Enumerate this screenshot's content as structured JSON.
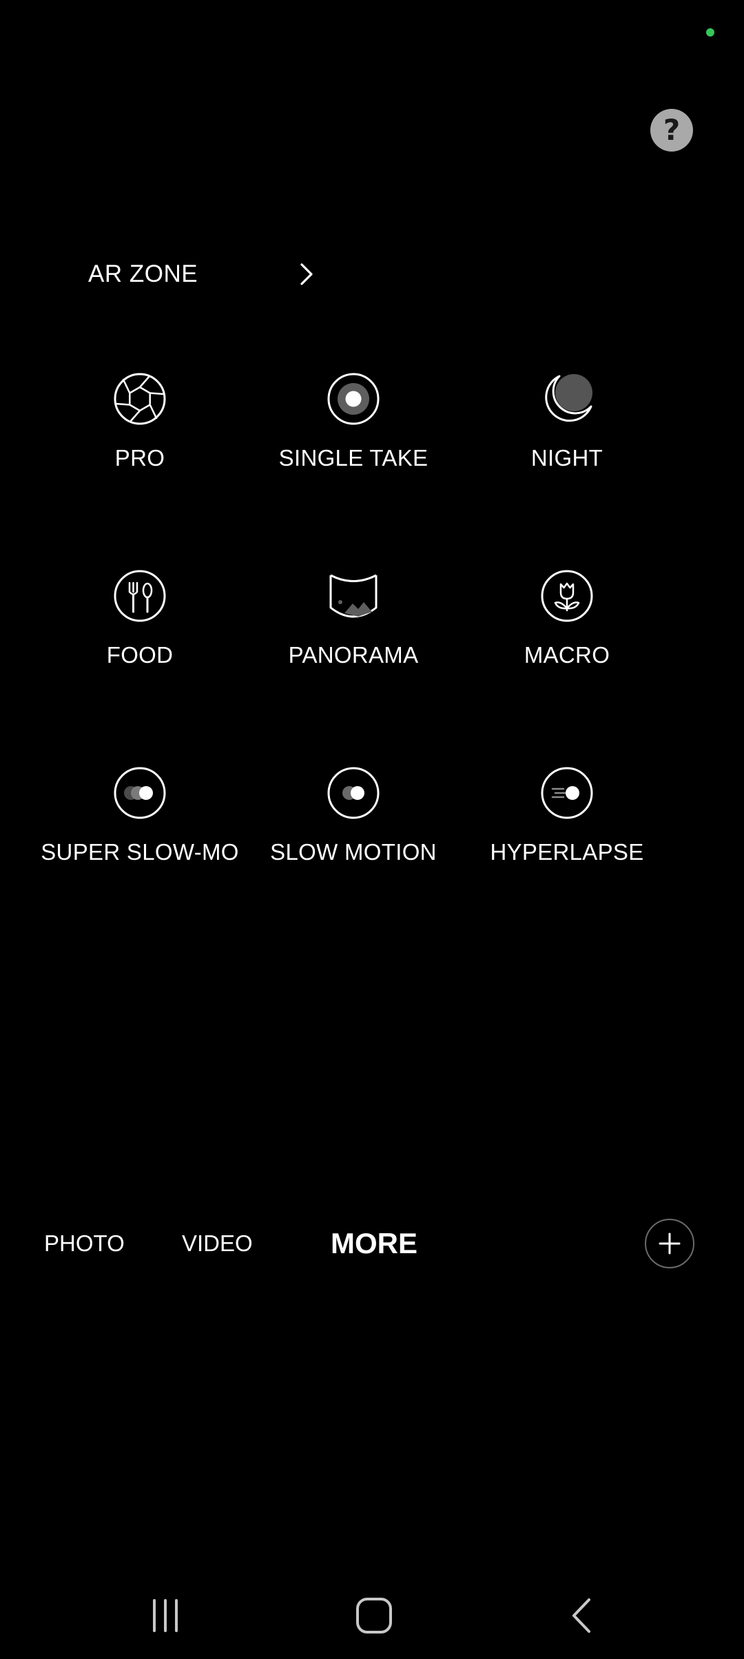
{
  "ar_zone": {
    "label": "AR ZONE"
  },
  "help": {
    "symbol": "?"
  },
  "modes": [
    {
      "label": "PRO",
      "icon": "aperture-icon"
    },
    {
      "label": "SINGLE TAKE",
      "icon": "single-take-icon"
    },
    {
      "label": "NIGHT",
      "icon": "moon-icon"
    },
    {
      "label": "FOOD",
      "icon": "fork-spoon-icon"
    },
    {
      "label": "PANORAMA",
      "icon": "panorama-icon"
    },
    {
      "label": "MACRO",
      "icon": "flower-icon"
    },
    {
      "label": "SUPER SLOW-MO",
      "icon": "super-slow-mo-icon"
    },
    {
      "label": "SLOW MOTION",
      "icon": "slow-motion-icon"
    },
    {
      "label": "HYPERLAPSE",
      "icon": "hyperlapse-icon"
    }
  ],
  "tabs": {
    "photo": "PHOTO",
    "video": "VIDEO",
    "more": "MORE",
    "active": "more"
  },
  "colors": {
    "background": "#000000",
    "text": "#ffffff",
    "status_dot": "#34c759",
    "help_button": "#a9a9a9"
  }
}
